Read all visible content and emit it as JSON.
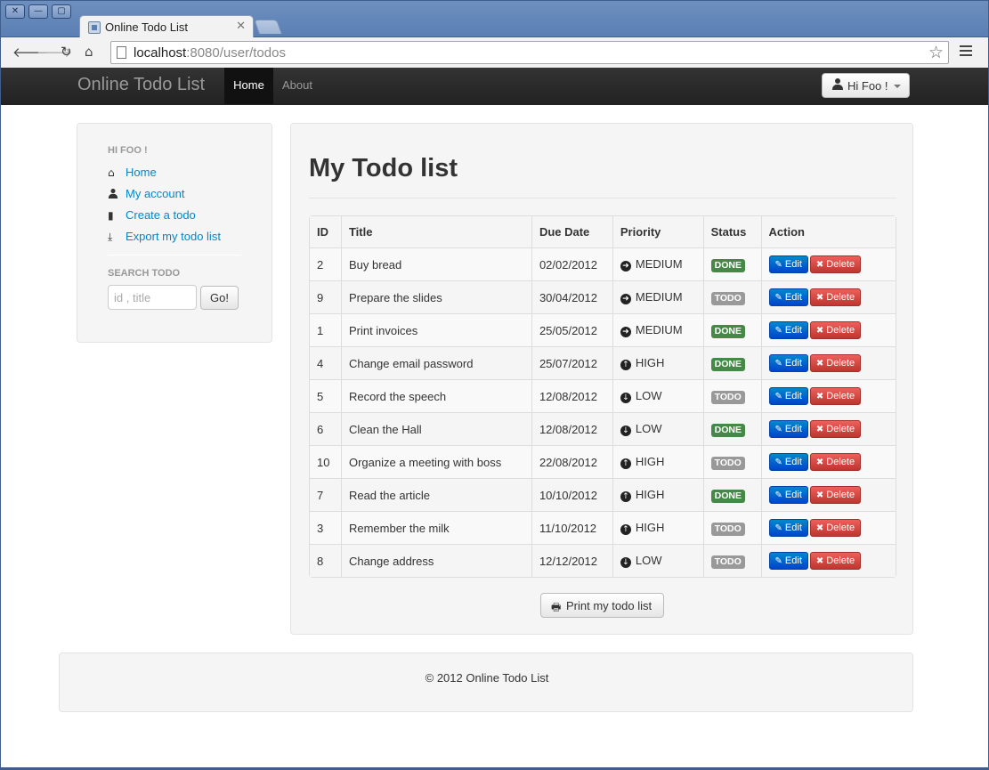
{
  "browser": {
    "window_buttons": [
      "✕",
      "—",
      "▢"
    ],
    "tab_title": "Online Todo List",
    "tab_close": "✕",
    "url_host": "localhost",
    "url_rest": ":8080/user/todos",
    "icons": [
      "back-icon",
      "forward-icon",
      "reload-icon",
      "home-icon",
      "star-icon",
      "menu-icon"
    ]
  },
  "navbar": {
    "brand": "Online Todo List",
    "links": [
      "Home",
      "About"
    ],
    "user_button": "Hi Foo !"
  },
  "sidebar": {
    "header": "HI FOO !",
    "links": [
      {
        "label": "Home",
        "icon": "home-icon"
      },
      {
        "label": "My account",
        "icon": "user-icon"
      },
      {
        "label": "Create a todo",
        "icon": "file-icon"
      },
      {
        "label": "Export my todo list",
        "icon": "download-icon"
      }
    ],
    "search_header": "SEARCH TODO",
    "search_placeholder": "id , title",
    "search_button": "Go!"
  },
  "main": {
    "title": "My Todo list",
    "columns": [
      "ID",
      "Title",
      "Due Date",
      "Priority",
      "Status",
      "Action"
    ],
    "rows": [
      {
        "id": "2",
        "title": "Buy bread",
        "due": "02/02/2012",
        "priority": "MEDIUM",
        "status": "DONE"
      },
      {
        "id": "9",
        "title": "Prepare the slides",
        "due": "30/04/2012",
        "priority": "MEDIUM",
        "status": "TODO"
      },
      {
        "id": "1",
        "title": "Print invoices",
        "due": "25/05/2012",
        "priority": "MEDIUM",
        "status": "DONE"
      },
      {
        "id": "4",
        "title": "Change email password",
        "due": "25/07/2012",
        "priority": "HIGH",
        "status": "DONE"
      },
      {
        "id": "5",
        "title": "Record the speech",
        "due": "12/08/2012",
        "priority": "LOW",
        "status": "TODO"
      },
      {
        "id": "6",
        "title": "Clean the Hall",
        "due": "12/08/2012",
        "priority": "LOW",
        "status": "DONE"
      },
      {
        "id": "10",
        "title": "Organize a meeting with boss",
        "due": "22/08/2012",
        "priority": "HIGH",
        "status": "TODO"
      },
      {
        "id": "7",
        "title": "Read the article",
        "due": "10/10/2012",
        "priority": "HIGH",
        "status": "DONE"
      },
      {
        "id": "3",
        "title": "Remember the milk",
        "due": "11/10/2012",
        "priority": "HIGH",
        "status": "TODO"
      },
      {
        "id": "8",
        "title": "Change address",
        "due": "12/12/2012",
        "priority": "LOW",
        "status": "TODO"
      }
    ],
    "edit_label": "Edit",
    "delete_label": "Delete",
    "print_button": "Print my todo list"
  },
  "footer": {
    "text": "© 2012 Online Todo List"
  },
  "colors": {
    "link": "#0088cc",
    "done": "#468847",
    "todo": "#999999",
    "edit": "#0044cc",
    "delete": "#bd362f"
  }
}
